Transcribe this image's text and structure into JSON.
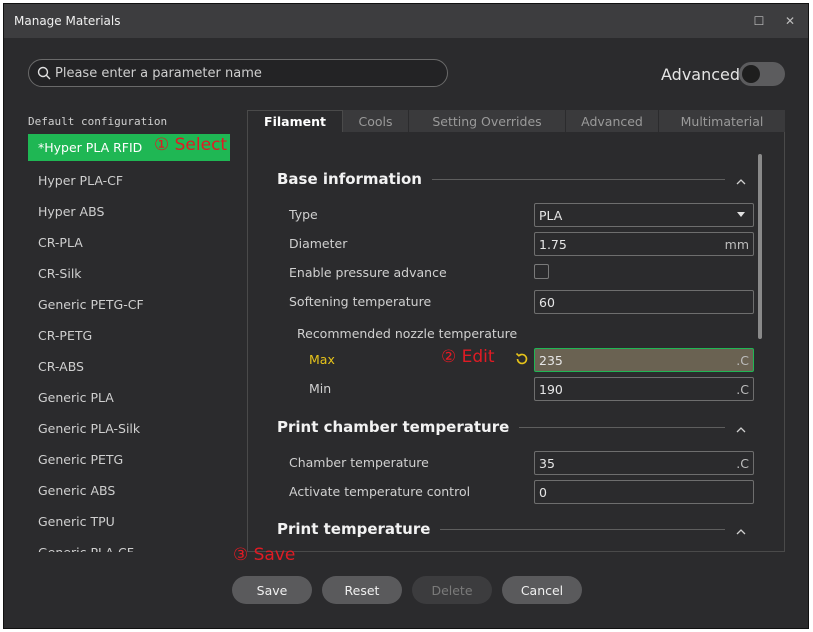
{
  "window": {
    "title": "Manage Materials"
  },
  "search": {
    "placeholder": "Please enter a parameter name"
  },
  "advanced_toggle": {
    "label": "Advanced"
  },
  "left_panel": {
    "title": "Default configuration",
    "items": [
      {
        "label": "*Hyper PLA RFID"
      },
      {
        "label": "Hyper PLA-CF"
      },
      {
        "label": "Hyper ABS"
      },
      {
        "label": "CR-PLA"
      },
      {
        "label": "CR-Silk"
      },
      {
        "label": "Generic PETG-CF"
      },
      {
        "label": "CR-PETG"
      },
      {
        "label": "CR-ABS"
      },
      {
        "label": "Generic PLA"
      },
      {
        "label": "Generic PLA-Silk"
      },
      {
        "label": "Generic PETG"
      },
      {
        "label": "Generic ABS"
      },
      {
        "label": "Generic TPU"
      },
      {
        "label": "Generic PLA-CF"
      }
    ]
  },
  "annotations": {
    "select": "① Select",
    "edit": "② Edit",
    "save": "③ Save"
  },
  "tabs": [
    {
      "label": "Filament"
    },
    {
      "label": "Cools"
    },
    {
      "label": "Setting Overrides"
    },
    {
      "label": "Advanced"
    },
    {
      "label": "Multimaterial"
    }
  ],
  "sections": {
    "base": {
      "title": "Base information"
    },
    "chamber": {
      "title": "Print chamber temperature"
    },
    "print_temp": {
      "title": "Print temperature"
    }
  },
  "fields": {
    "type": {
      "label": "Type",
      "value": "PLA"
    },
    "diameter": {
      "label": "Diameter",
      "value": "1.75",
      "unit": "mm"
    },
    "pressure_advance": {
      "label": "Enable pressure advance"
    },
    "softening": {
      "label": "Softening temperature",
      "value": "60"
    },
    "nozzle_group": {
      "label": "Recommended nozzle temperature"
    },
    "max": {
      "label": "Max",
      "value": "235",
      "unit": ".C"
    },
    "min": {
      "label": "Min",
      "value": "190",
      "unit": ".C"
    },
    "chamber_temp": {
      "label": "Chamber temperature",
      "value": "35",
      "unit": ".C"
    },
    "temp_control": {
      "label": "Activate temperature control",
      "value": "0"
    }
  },
  "footer": {
    "save": "Save",
    "reset": "Reset",
    "delete": "Delete",
    "cancel": "Cancel"
  },
  "colors": {
    "accent_green": "#1fb754",
    "annotation_red": "#e01b24",
    "label_yellow": "#e6c31a"
  }
}
